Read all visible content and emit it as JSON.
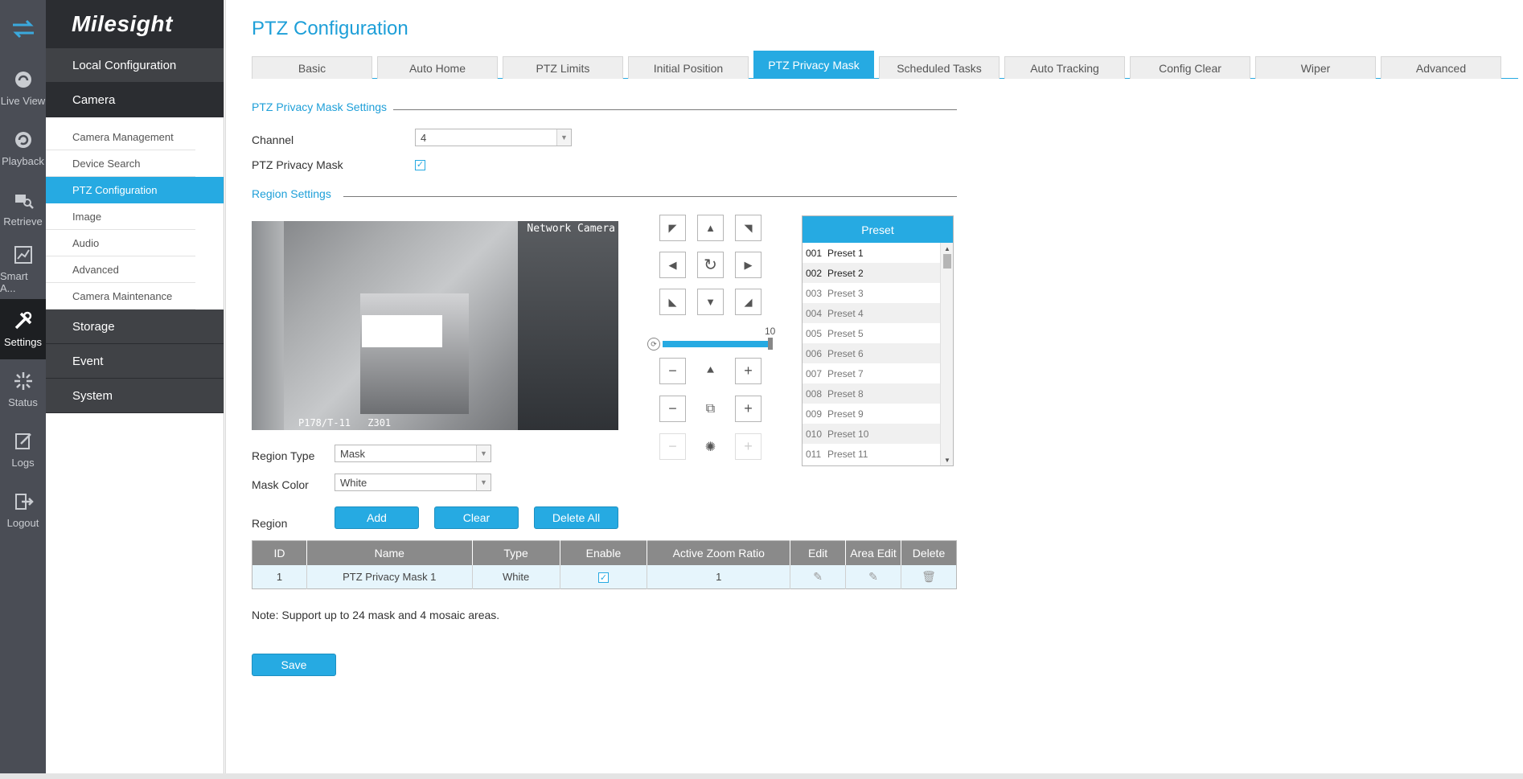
{
  "brand": {
    "name": "Milesight"
  },
  "rail": [
    {
      "label": "Live View",
      "icon": "live-view-icon"
    },
    {
      "label": "Playback",
      "icon": "playback-icon"
    },
    {
      "label": "Retrieve",
      "icon": "retrieve-icon"
    },
    {
      "label": "Smart A...",
      "icon": "smart-analytics-icon"
    },
    {
      "label": "Settings",
      "icon": "settings-icon",
      "active": true
    },
    {
      "label": "Status",
      "icon": "status-icon"
    },
    {
      "label": "Logs",
      "icon": "logs-icon"
    },
    {
      "label": "Logout",
      "icon": "logout-icon"
    }
  ],
  "sidebar": {
    "local_configuration": "Local Configuration",
    "camera": "Camera",
    "camera_items": [
      "Camera Management",
      "Device Search",
      "PTZ Configuration",
      "Image",
      "Audio",
      "Advanced",
      "Camera Maintenance"
    ],
    "active_item": "PTZ Configuration",
    "storage": "Storage",
    "event": "Event",
    "system": "System"
  },
  "page": {
    "title": "PTZ Configuration"
  },
  "tabs": [
    "Basic",
    "Auto Home",
    "PTZ Limits",
    "Initial Position",
    "PTZ Privacy Mask",
    "Scheduled Tasks",
    "Auto Tracking",
    "Config Clear",
    "Wiper",
    "Advanced"
  ],
  "active_tab": "PTZ Privacy Mask",
  "mask_settings": {
    "header": "PTZ Privacy Mask Settings",
    "channel_label": "Channel",
    "channel_value": "4",
    "privacy_mask_label": "PTZ Privacy Mask",
    "privacy_mask_enabled": true
  },
  "region_settings": {
    "header": "Region Settings",
    "video_overlay_top": "Network Camera",
    "video_overlay_bottom": "P178/T-11 Z301",
    "region_type_label": "Region Type",
    "region_type_value": "Mask",
    "mask_color_label": "Mask Color",
    "mask_color_value": "White",
    "region_label": "Region",
    "add_label": "Add",
    "clear_label": "Clear",
    "delete_all_label": "Delete All"
  },
  "ptz": {
    "speed_value": "10",
    "speed_fraction": 1.0
  },
  "preset": {
    "header": "Preset",
    "items": [
      {
        "no": "001",
        "name": "Preset 1"
      },
      {
        "no": "002",
        "name": "Preset 2"
      },
      {
        "no": "003",
        "name": "Preset 3"
      },
      {
        "no": "004",
        "name": "Preset 4"
      },
      {
        "no": "005",
        "name": "Preset 5"
      },
      {
        "no": "006",
        "name": "Preset 6"
      },
      {
        "no": "007",
        "name": "Preset 7"
      },
      {
        "no": "008",
        "name": "Preset 8"
      },
      {
        "no": "009",
        "name": "Preset 9"
      },
      {
        "no": "010",
        "name": "Preset 10"
      },
      {
        "no": "011",
        "name": "Preset 11"
      }
    ]
  },
  "table": {
    "headers": [
      "ID",
      "Name",
      "Type",
      "Enable",
      "Active Zoom Ratio",
      "Edit",
      "Area Edit",
      "Delete"
    ],
    "rows": [
      {
        "id": "1",
        "name": "PTZ Privacy Mask 1",
        "type": "White",
        "enable": true,
        "zoom": "1"
      }
    ]
  },
  "note": "Note: Support up to 24 mask and 4 mosaic areas.",
  "save_label": "Save",
  "colors": {
    "accent": "#26aae2",
    "sidebar_dark": "#2b2d31",
    "rail": "#4a4d55"
  }
}
